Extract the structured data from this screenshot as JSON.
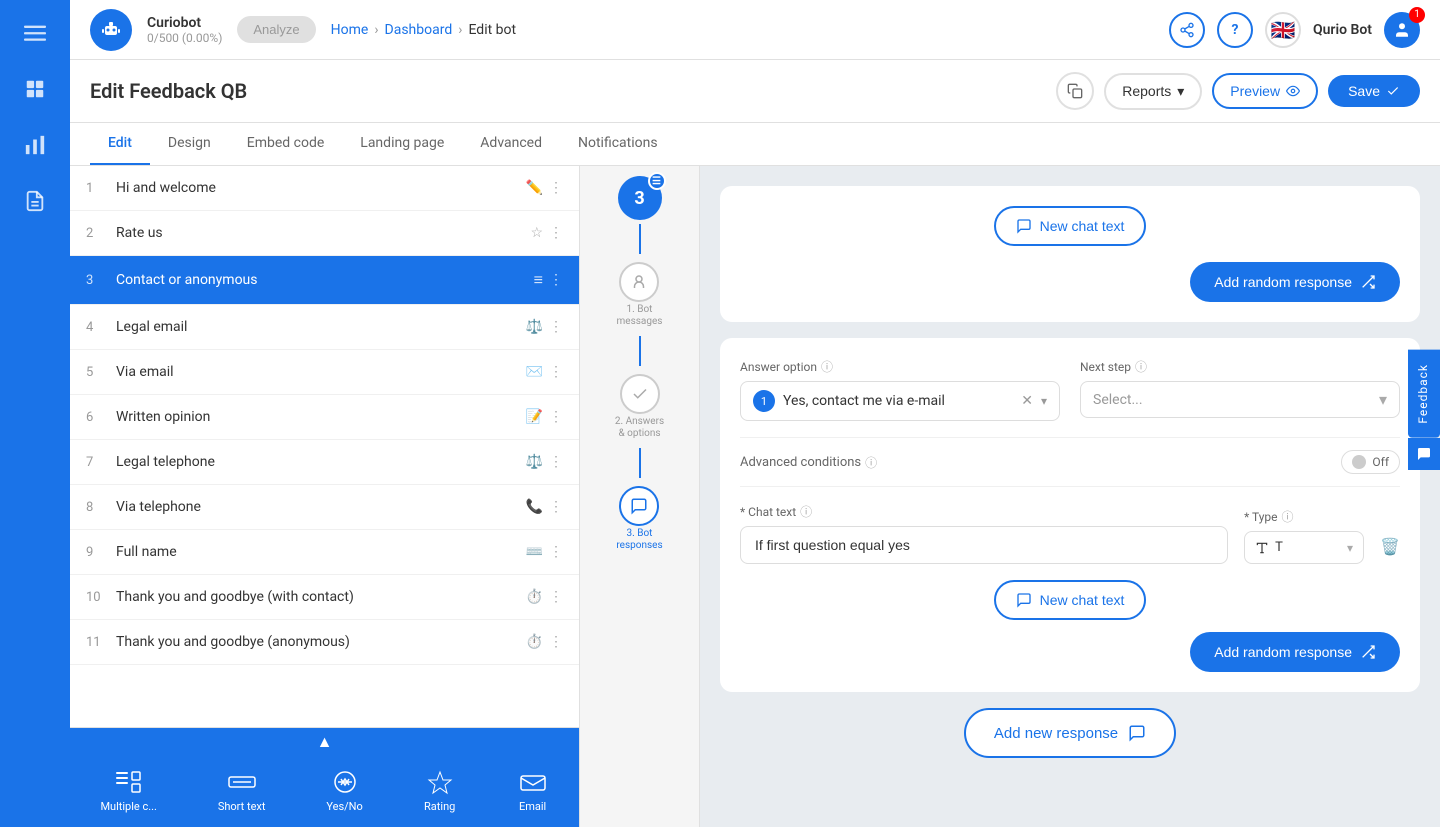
{
  "sidebar": {
    "icons": [
      {
        "name": "menu-icon",
        "symbol": "≡"
      },
      {
        "name": "dashboard-icon",
        "symbol": "⊞"
      },
      {
        "name": "chart-icon",
        "symbol": "📊"
      },
      {
        "name": "document-icon",
        "symbol": "📄"
      }
    ]
  },
  "topbar": {
    "bot_name": "Curiobot",
    "bot_count": "0/500 (0.00%)",
    "analyze_label": "Analyze",
    "breadcrumb": {
      "home": "Home",
      "dashboard": "Dashboard",
      "current": "Edit bot"
    },
    "share_icon": "share",
    "help_icon": "?",
    "flag": "🇬🇧",
    "user_name": "Qurio Bot",
    "notification_count": "1"
  },
  "page_header": {
    "title": "Edit Feedback QB",
    "copy_label": "copy",
    "reports_label": "Reports",
    "preview_label": "Preview",
    "save_label": "Save"
  },
  "tabs": [
    {
      "label": "Edit",
      "active": true
    },
    {
      "label": "Design",
      "active": false
    },
    {
      "label": "Embed code",
      "active": false
    },
    {
      "label": "Landing page",
      "active": false
    },
    {
      "label": "Advanced",
      "active": false
    },
    {
      "label": "Notifications",
      "active": false
    }
  ],
  "questions": [
    {
      "num": "1",
      "label": "Hi and welcome",
      "icon": "✏️"
    },
    {
      "num": "2",
      "label": "Rate us",
      "icon": "⭐"
    },
    {
      "num": "3",
      "label": "Contact or anonymous",
      "icon": "≡",
      "active": true
    },
    {
      "num": "4",
      "label": "Legal email",
      "icon": "⚖️"
    },
    {
      "num": "5",
      "label": "Via email",
      "icon": "✉️"
    },
    {
      "num": "6",
      "label": "Written opinion",
      "icon": "📝"
    },
    {
      "num": "7",
      "label": "Legal telephone",
      "icon": "⚖️"
    },
    {
      "num": "8",
      "label": "Via telephone",
      "icon": "📞"
    },
    {
      "num": "9",
      "label": "Full name",
      "icon": "⌨️"
    },
    {
      "num": "10",
      "label": "Thank you and goodbye (with contact)",
      "icon": "⏱️"
    },
    {
      "num": "11",
      "label": "Thank you and goodbye (anonymous)",
      "icon": "⏱️"
    }
  ],
  "toolbar": {
    "items": [
      {
        "label": "Multiple c...",
        "icon": "multiple"
      },
      {
        "label": "Short text",
        "icon": "short-text"
      },
      {
        "label": "Yes/No",
        "icon": "yes-no"
      },
      {
        "label": "Rating",
        "icon": "rating"
      },
      {
        "label": "Email",
        "icon": "email"
      }
    ]
  },
  "steps": {
    "active": "3",
    "items": [
      {
        "num": "1",
        "label": "Bot messages",
        "icon": "🤖"
      },
      {
        "num": "2",
        "label": "Answers & options",
        "icon": "✓"
      },
      {
        "num": "3",
        "label": "Bot responses",
        "icon": "💬",
        "active": true
      }
    ]
  },
  "right_panel": {
    "new_chat_text_label": "New chat text",
    "add_random_label": "Add random response",
    "answer_option_label": "Answer option",
    "next_step_label": "Next step",
    "answer_text": "Yes, contact me via e-mail",
    "select_placeholder": "Select...",
    "advanced_conditions_label": "Advanced conditions",
    "toggle_label": "Off",
    "chat_text_label": "* Chat text",
    "type_label": "* Type",
    "chat_text_value": "If first question equal yes",
    "new_chat_text_label2": "New chat text",
    "add_random_label2": "Add random response",
    "add_new_response_label": "Add new response"
  },
  "feedback": {
    "tab_label": "Feedback"
  }
}
